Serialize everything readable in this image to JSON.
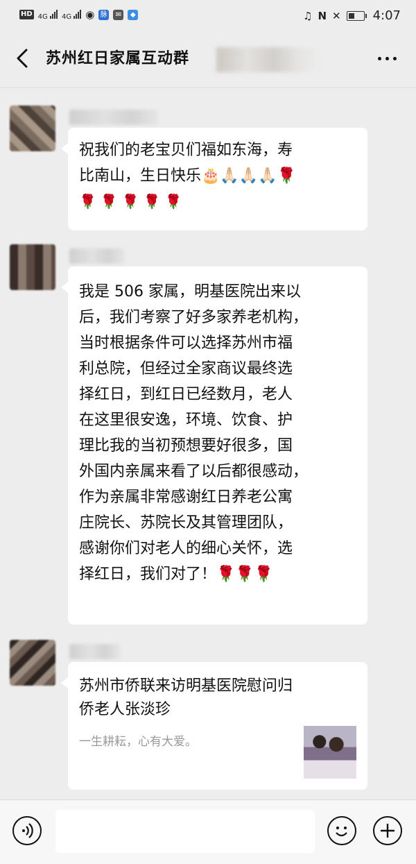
{
  "status_bar": {
    "left_chips": [
      "HD",
      "4G",
      "4G"
    ],
    "app_labels": [
      "脉"
    ],
    "time": "4:07",
    "icons": [
      "signal-icon",
      "wifi-icon",
      "vibrate-icon",
      "nfc-icon",
      "mute-icon",
      "battery-icon"
    ]
  },
  "header": {
    "title": "苏州红日家属互动群",
    "back_icon": "chevron-left-icon",
    "more_icon": "more-icon"
  },
  "messages": [
    {
      "lines": [
        "祝我们的老宝贝们福如东海，寿",
        "比南山，生日快乐🎂🙏🏻🙏🏻🙏🏻🌹",
        "🌹🌹🌹🌹🌹"
      ]
    },
    {
      "lines": [
        "我是 506 家属，明基医院出来以",
        "后，我们考察了好多家养老机构，",
        "当时根据条件可以选择苏州市福",
        "利总院，但经过全家商议最终选",
        "择红日，到红日已经数月，老人",
        "在这里很安逸，环境、饮食、护",
        "理比我的当初预想要好很多，国",
        "外国内亲属来看了以后都很感动，",
        "作为亲属非常感谢红日养老公寓",
        "庄院长、苏院长及其管理团队，",
        "感谢你们对老人的细心关怀，选",
        "择红日，我们对了！🌹🌹🌹"
      ]
    }
  ],
  "link_card": {
    "title_lines": [
      "苏州市侨联来访明基医院慰问归",
      "侨老人张淡珍"
    ],
    "description": "一生耕耘，心有大爱。"
  },
  "input_bar": {
    "voice_icon": "voice-icon",
    "emoji_icon": "emoji-icon",
    "plus_icon": "plus-icon"
  },
  "colors": {
    "background": "#ededed",
    "bubble": "#ffffff",
    "rose": "#c2222b"
  }
}
